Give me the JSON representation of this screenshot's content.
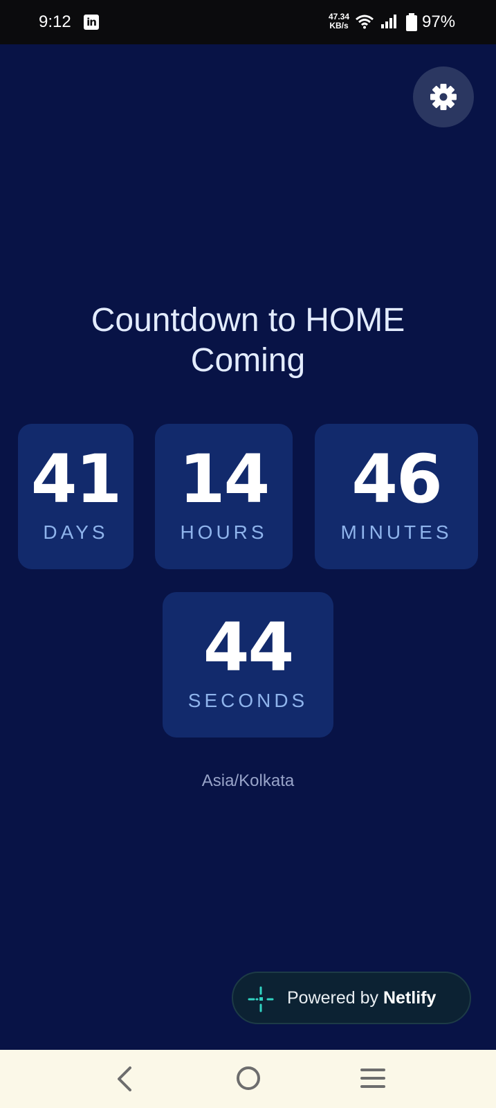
{
  "status_bar": {
    "time": "9:12",
    "app_icon": "linkedin-icon",
    "net_speed_value": "47.34",
    "net_speed_unit": "KB/s",
    "battery_percent": "97%"
  },
  "settings": {
    "icon": "gear-icon"
  },
  "title": {
    "line1": "Countdown to HOME",
    "line2": "Coming"
  },
  "countdown": {
    "days": {
      "value": "41",
      "label": "DAYS"
    },
    "hours": {
      "value": "14",
      "label": "HOURS"
    },
    "minutes": {
      "value": "46",
      "label": "MINUTES"
    },
    "seconds": {
      "value": "44",
      "label": "SECONDS"
    }
  },
  "timezone": "Asia/Kolkata",
  "netlify_badge": {
    "prefix": "Powered by ",
    "brand": "Netlify",
    "icon": "netlify-icon"
  },
  "colors": {
    "background": "#081346",
    "card": "#122a6c",
    "unit_label": "#8fb4ec",
    "nav_bar": "#fbf8e8"
  }
}
